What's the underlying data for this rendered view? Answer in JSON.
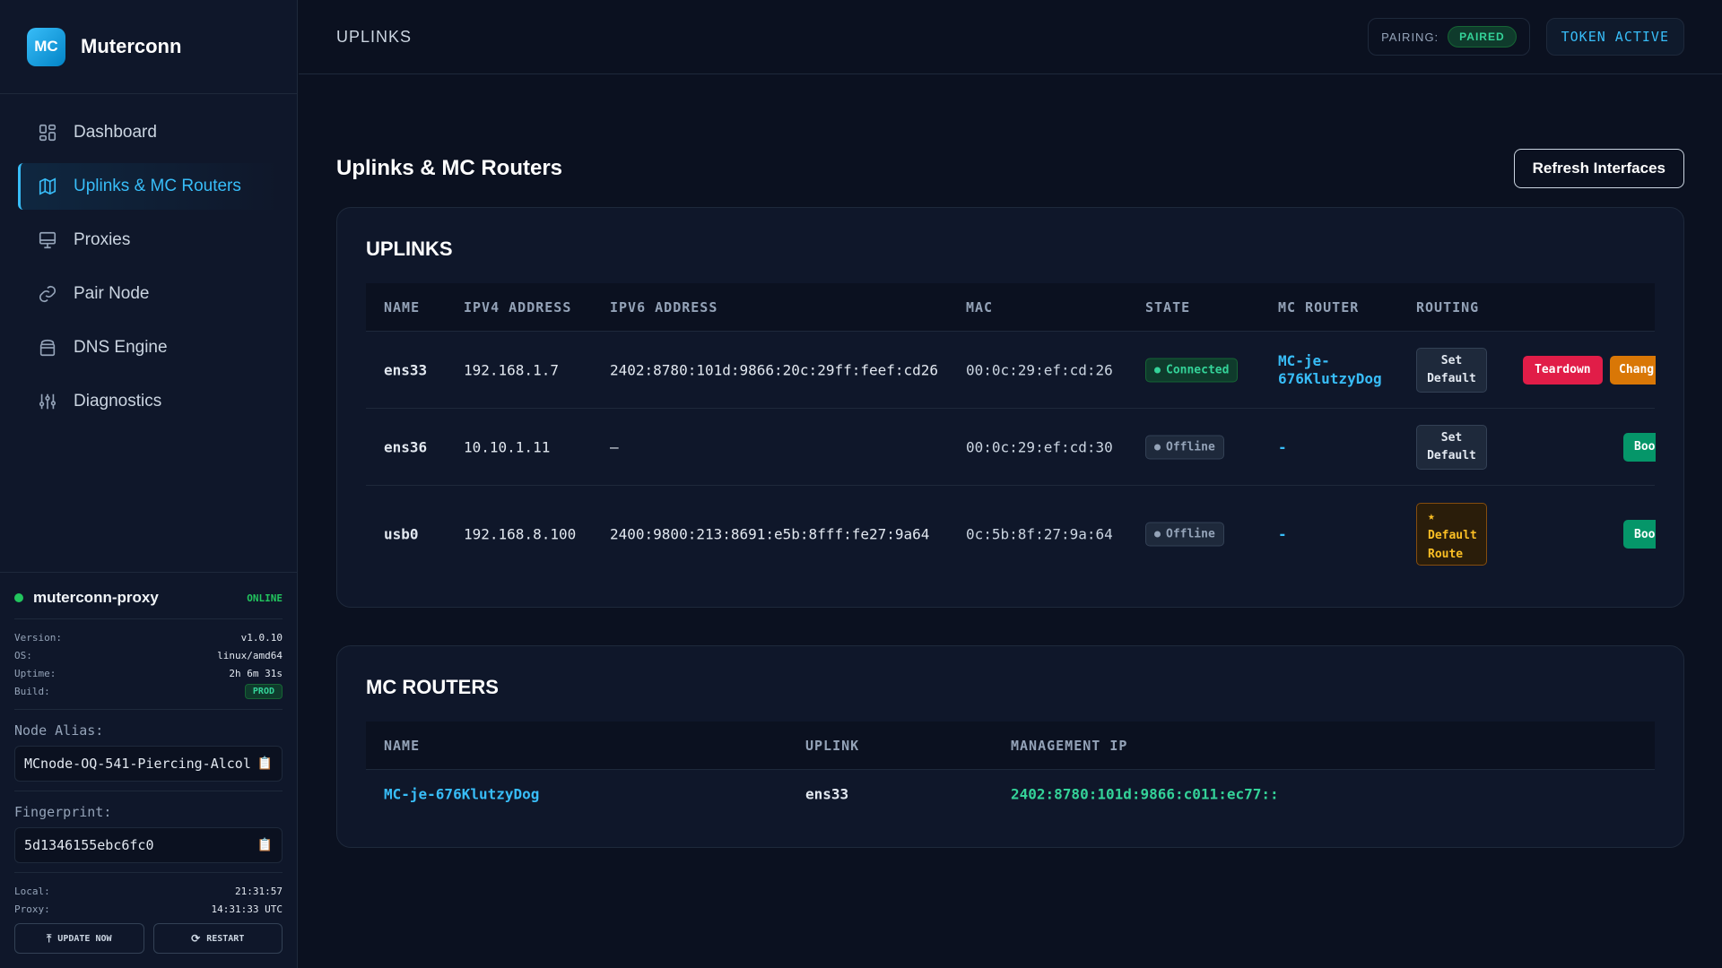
{
  "app": {
    "initials": "MC",
    "name": "Muterconn"
  },
  "nav": [
    {
      "label": "Dashboard",
      "icon": "grid-icon"
    },
    {
      "label": "Uplinks & MC Routers",
      "icon": "map-icon",
      "active": true
    },
    {
      "label": "Proxies",
      "icon": "monitor-icon"
    },
    {
      "label": "Pair Node",
      "icon": "link-icon"
    },
    {
      "label": "DNS Engine",
      "icon": "database-icon"
    },
    {
      "label": "Diagnostics",
      "icon": "sliders-icon"
    }
  ],
  "node": {
    "name": "muterconn-proxy",
    "status": "ONLINE",
    "version_label": "Version:",
    "version": "v1.0.10",
    "os_label": "OS:",
    "os": "linux/amd64",
    "uptime_label": "Uptime:",
    "uptime": "2h 6m 31s",
    "build_label": "Build:",
    "build": "PROD",
    "alias_label": "Node Alias:",
    "alias": "MCnode-OQ-541-Piercing-Alcol",
    "fingerprint_label": "Fingerprint:",
    "fingerprint": "5d1346155ebc6fc0",
    "local_label": "Local:",
    "local": "21:31:57",
    "proxy_label": "Proxy:",
    "proxy": "14:31:33 UTC",
    "update_label": "UPDATE NOW",
    "restart_label": "RESTART"
  },
  "topbar": {
    "title": "UPLINKS",
    "pairing_label": "PAIRING:",
    "pairing_status": "PAIRED",
    "token": "TOKEN ACTIVE"
  },
  "main": {
    "title": "Uplinks & MC Routers",
    "refresh_label": "Refresh Interfaces"
  },
  "uplinks": {
    "title": "UPLINKS",
    "columns": [
      "NAME",
      "IPV4 ADDRESS",
      "IPV6 ADDRESS",
      "MAC",
      "STATE",
      "MC ROUTER",
      "ROUTING"
    ],
    "rows": [
      {
        "name": "ens33",
        "ipv4": "192.168.1.7",
        "ipv6": "2402:8780:101d:9866:20c:29ff:feef:cd26",
        "mac": "00:0c:29:ef:cd:26",
        "state": "Connected",
        "router_line1": "MC-je-",
        "router_line2": "676KlutzyDog",
        "routing_line1": "Set",
        "routing_line2": "Default",
        "action1": "Teardown",
        "action2": "Chang"
      },
      {
        "name": "ens36",
        "ipv4": "10.10.1.11",
        "ipv6": "—",
        "mac": "00:0c:29:ef:cd:30",
        "state": "Offline",
        "router": "-",
        "routing_line1": "Set",
        "routing_line2": "Default",
        "action1": "Boo"
      },
      {
        "name": "usb0",
        "ipv4": "192.168.8.100",
        "ipv6": "2400:9800:213:8691:e5b:8fff:fe27:9a64",
        "mac": "0c:5b:8f:27:9a:64",
        "state": "Offline",
        "router": "-",
        "routing_star": "★",
        "routing_line1": "Default",
        "routing_line2": "Route",
        "action1": "Boo"
      }
    ]
  },
  "routers": {
    "title": "MC ROUTERS",
    "columns": [
      "NAME",
      "UPLINK",
      "MANAGEMENT IP"
    ],
    "rows": [
      {
        "name": "MC-je-676KlutzyDog",
        "uplink": "ens33",
        "mgmt_ip": "2402:8780:101d:9866:c011:ec77::"
      }
    ]
  },
  "colors": {
    "accent": "#38bdf8",
    "success": "#34d399",
    "danger": "#e11d48",
    "warning": "#d97706",
    "background": "#0b1120"
  }
}
